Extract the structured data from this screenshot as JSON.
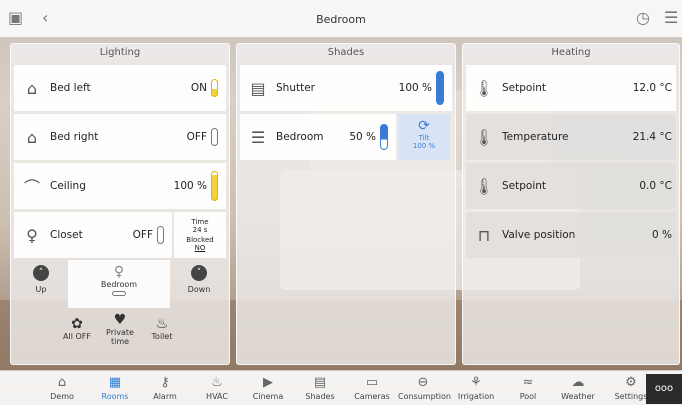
{
  "header": {
    "title": "Bedroom",
    "back_label": "‹"
  },
  "panels": {
    "lighting": {
      "title": "Lighting",
      "rows": [
        {
          "label": "Bed left",
          "value": "ON"
        },
        {
          "label": "Bed right",
          "value": "OFF"
        },
        {
          "label": "Ceiling",
          "value": "100 %"
        },
        {
          "label": "Closet",
          "value": "OFF"
        }
      ],
      "closet_timer": {
        "label": "Time",
        "value": "24 s",
        "blocked": "Blocked",
        "no": "NO"
      },
      "scenes": {
        "up": "Up",
        "bedroom": "Bedroom",
        "down": "Down",
        "all_off": "All OFF",
        "private_time": "Private time",
        "toilet": "Toilet"
      }
    },
    "shades": {
      "title": "Shades",
      "rows": [
        {
          "label": "Shutter",
          "value": "100 %"
        },
        {
          "label": "Bedroom",
          "value": "50 %"
        }
      ],
      "tilt": {
        "label": "Tilt",
        "value": "100 %"
      }
    },
    "heating": {
      "title": "Heating",
      "rows": [
        {
          "label": "Setpoint",
          "value": "12.0 °C"
        },
        {
          "label": "Temperature",
          "value": "21.4 °C"
        },
        {
          "label": "Setpoint",
          "value": "0.0 °C"
        },
        {
          "label": "Valve position",
          "value": "0 %"
        }
      ]
    }
  },
  "nav": {
    "items": [
      {
        "label": "Demo"
      },
      {
        "label": "Rooms"
      },
      {
        "label": "Alarm"
      },
      {
        "label": "HVAC"
      },
      {
        "label": "Cinema"
      },
      {
        "label": "Shades"
      },
      {
        "label": "Cameras"
      },
      {
        "label": "Consumption"
      },
      {
        "label": "Irrigation"
      },
      {
        "label": "Pool"
      },
      {
        "label": "Weather"
      },
      {
        "label": "Settings"
      }
    ],
    "more": "ooo"
  },
  "colors": {
    "accent": "#2d7fd3",
    "switch_on": "#f4d23a",
    "shade": "#3a7bd5"
  }
}
